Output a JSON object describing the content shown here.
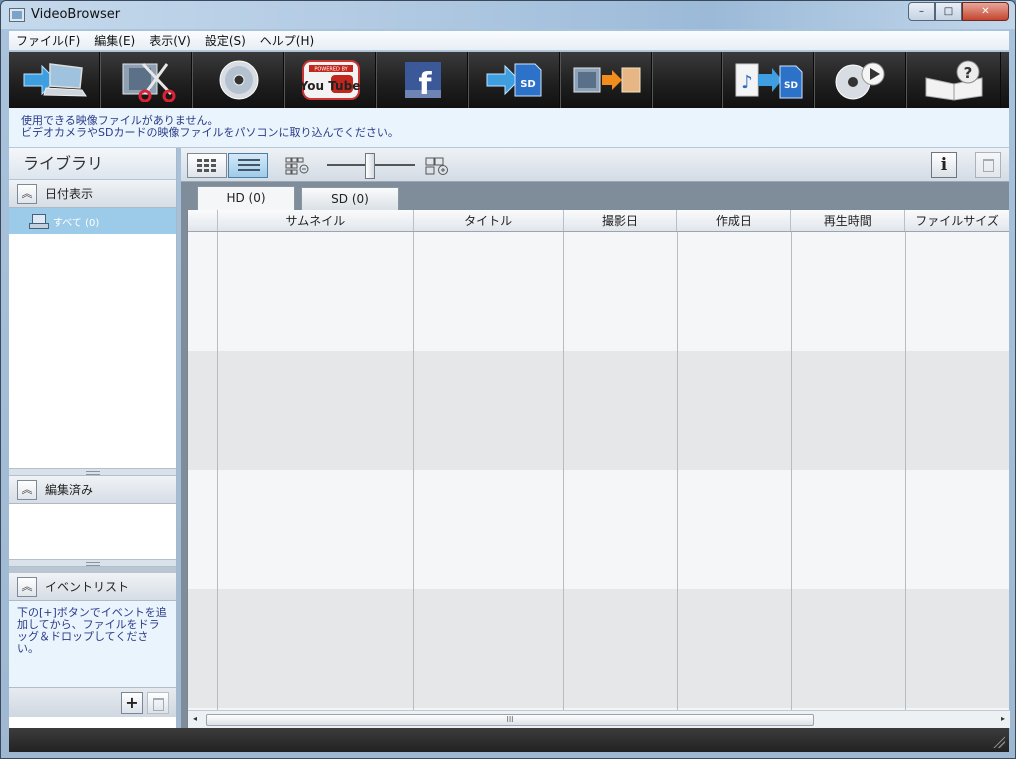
{
  "window": {
    "title": "VideoBrowser",
    "min": "–",
    "max": "□",
    "close": "✕"
  },
  "menu": [
    "ファイル(F)",
    "編集(E)",
    "表示(V)",
    "設定(S)",
    "ヘルプ(H)"
  ],
  "toolbar": {
    "buttons": [
      "import-from-camera",
      "edit",
      "create-disc",
      "upload-youtube",
      "upload-facebook",
      "copy-to-sd",
      "convert-video",
      "music-to-sd",
      "play-disc",
      "help-manual"
    ],
    "youtube_text": "You Tube",
    "youtube_powered": "POWERED BY",
    "facebook_text": "f",
    "sd_text": "SD"
  },
  "info": {
    "line1": "使用できる映像ファイルがありません。",
    "line2": "ビデオカメラやSDカードの映像ファイルをパソコンに取り込んでください。"
  },
  "library": {
    "title": "ライブラリ",
    "date_section": "日付表示",
    "all_item": "すべて (0)",
    "edited_section": "編集済み",
    "event_section": "イベントリスト",
    "event_hint": "下の[+]ボタンでイベントを追加してから、ファイルをドラッグ＆ドロップしてください。",
    "add_button": "+",
    "chevron": "︽"
  },
  "content": {
    "info_label": "i",
    "tabs": [
      "HD (0)",
      "SD (0)"
    ],
    "columns": [
      "サムネイル",
      "タイトル",
      "撮影日",
      "作成日",
      "再生時間",
      "ファイルサイズ"
    ],
    "scroll_thumb": "III",
    "scroll_left": "◂",
    "scroll_right": "▸"
  }
}
